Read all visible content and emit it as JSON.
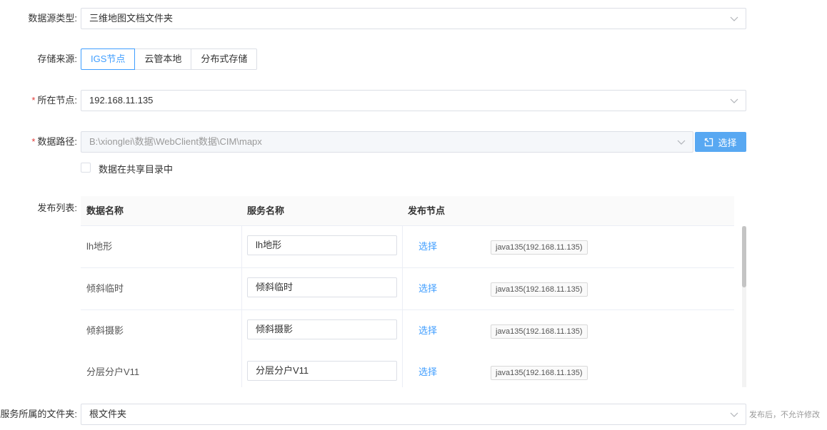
{
  "data_source_type": {
    "label": "数据源类型:",
    "value": "三维地图文档文件夹"
  },
  "storage_source": {
    "label": "存储来源:",
    "options": [
      "IGS节点",
      "云管本地",
      "分布式存储"
    ],
    "selected": "IGS节点"
  },
  "node": {
    "required_mark": "*",
    "label": "所在节点:",
    "value": "192.168.11.135"
  },
  "data_path": {
    "required_mark": "*",
    "label": "数据路径:",
    "value": "B:\\xionglei\\数据\\WebClient数据\\CIM\\mapx",
    "select_button": "选择",
    "shared_checkbox_label": "数据在共享目录中"
  },
  "publish_list": {
    "label": "发布列表:",
    "columns": [
      "数据名称",
      "服务名称",
      "发布节点"
    ],
    "rows": [
      {
        "data_name": "lh地形",
        "service_name": "lh地形",
        "action": "选择",
        "node_tag": "java135(192.168.11.135)"
      },
      {
        "data_name": "倾斜临时",
        "service_name": "倾斜临时",
        "action": "选择",
        "node_tag": "java135(192.168.11.135)"
      },
      {
        "data_name": "倾斜摄影",
        "service_name": "倾斜摄影",
        "action": "选择",
        "node_tag": "java135(192.168.11.135)"
      },
      {
        "data_name": "分层分户V11",
        "service_name": "分层分户V11",
        "action": "选择",
        "node_tag": "java135(192.168.11.135)"
      }
    ]
  },
  "service_folder": {
    "label": "服务所属的文件夹:",
    "value": "根文件夹",
    "note": "发布后，不允许修改"
  },
  "colors": {
    "primary": "#409eff",
    "button": "#58a8f2",
    "required": "#e23c39",
    "border": "#dcdfe6"
  },
  "icons": [
    "chevron-down-icon",
    "select-folder-icon"
  ]
}
